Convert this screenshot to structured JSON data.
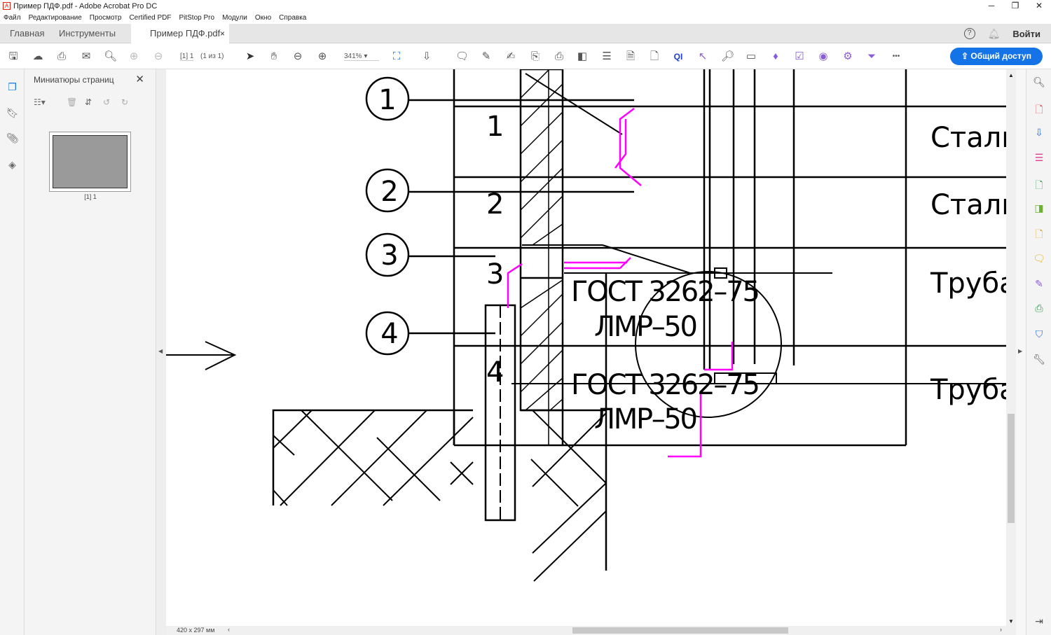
{
  "window": {
    "title": "Пример ПДФ.pdf - Adobe Acrobat Pro DC",
    "minimize": "─",
    "restore": "❐",
    "close": "✕"
  },
  "menu": [
    "Файл",
    "Редактирование",
    "Просмотр",
    "Certified PDF",
    "PitStop Pro",
    "Модули",
    "Окно",
    "Справка"
  ],
  "tabs": {
    "home": "Главная",
    "tools": "Инструменты",
    "document": "Пример ПДФ.pdf",
    "close": "×",
    "help": "?",
    "signin": "Войти"
  },
  "toolbar": {
    "page_current": "[1] 1",
    "page_of": "(1 из 1)",
    "zoom": "341%",
    "share": "Общий доступ",
    "more": "•••"
  },
  "thumbnails": {
    "title": "Миниатюры страниц",
    "page_label": "[1] 1"
  },
  "status": {
    "page_size": "420 x 297 мм"
  },
  "drawing": {
    "callouts": [
      "1",
      "2",
      "3",
      "4"
    ],
    "row_numbers": [
      "1",
      "2",
      "3",
      "4"
    ],
    "gost": [
      "ГОСТ 3262–75",
      "ГОСТ 3262–75"
    ],
    "lmr": [
      "ЛМР–50",
      "ЛМР–50"
    ],
    "materials": [
      "Сталь",
      "Сталь",
      "Труба",
      "Труба"
    ],
    "colors": {
      "markup": "#ff00ff",
      "line": "#000000"
    }
  },
  "colors": {
    "accent": "#1473e6"
  }
}
